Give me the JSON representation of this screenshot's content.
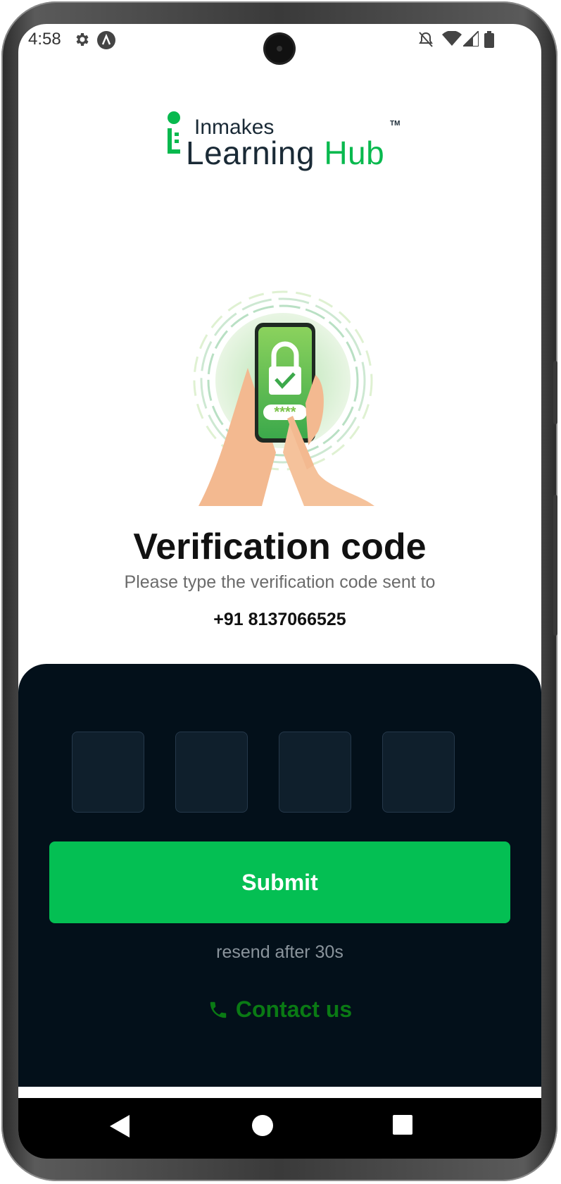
{
  "status_bar": {
    "time": "4:58",
    "left_icons": [
      "settings-icon",
      "app-notification-icon"
    ],
    "right_icons": [
      "silent-bell-icon",
      "wifi-icon",
      "signal-icon",
      "battery-icon"
    ]
  },
  "brand": {
    "top_text": "Inmakes",
    "bottom_text": "Learning",
    "bottom_accent": "Hub",
    "trademark": "TM",
    "accent_color": "#08b94e"
  },
  "illustration": {
    "icon": "phone-lock-verification-illustration",
    "pin_mask": "****"
  },
  "page": {
    "title": "Verification code",
    "subtitle": "Please type the verification code sent to",
    "phone_number": "+91 8137066525"
  },
  "otp": {
    "digits": [
      "",
      "",
      "",
      ""
    ]
  },
  "actions": {
    "submit_label": "Submit",
    "submit_color": "#04bf53",
    "resend_text": "resend after 30s",
    "contact_label": "Contact us",
    "contact_color": "#0a7a14"
  },
  "colors": {
    "sheet_background": "#03101a",
    "otp_box_background": "#0f1f2c"
  },
  "nav_bar": {
    "buttons": [
      "back-icon",
      "home-icon",
      "recents-icon"
    ]
  }
}
